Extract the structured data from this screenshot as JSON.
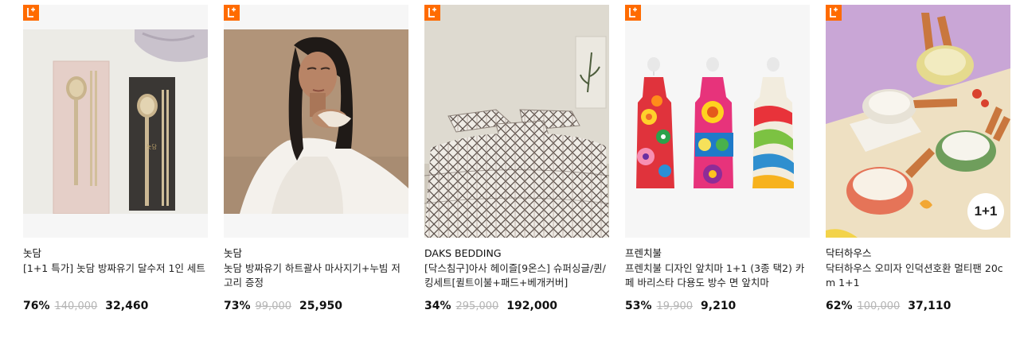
{
  "colors": {
    "lplus_badge": "#ff6b00",
    "original_price": "#b5b5b5"
  },
  "products": [
    {
      "brand": "놋담",
      "title": "[1+1 특가] 놋담 방짜유기 달수저 1인 세트",
      "discount": "76%",
      "original_price": "140,000",
      "sale_price": "32,460",
      "badge": "L+"
    },
    {
      "brand": "놋담",
      "title": "놋담 방짜유기 하트괄사 마사지기+누빔 저고리 증정",
      "discount": "73%",
      "original_price": "99,000",
      "sale_price": "25,950",
      "badge": "L+"
    },
    {
      "brand": "DAKS BEDDING",
      "title": "[닥스침구]아사 헤이즐[9온스] 슈퍼싱글/퀸/킹세트[퀼트이불+패드+베개커버]",
      "discount": "34%",
      "original_price": "295,000",
      "sale_price": "192,000",
      "badge": "L+"
    },
    {
      "brand": "프렌치불",
      "title": "프렌치불 디자인 앞치마 1+1 (3종 택2) 카페 바리스타 다용도 방수 면 앞치마",
      "discount": "53%",
      "original_price": "19,900",
      "sale_price": "9,210",
      "badge": "L+"
    },
    {
      "brand": "닥터하우스",
      "title": "닥터하우스 오미자 인덕션호환 멀티팬 20cm 1+1",
      "discount": "62%",
      "original_price": "100,000",
      "sale_price": "37,110",
      "badge": "L+",
      "promo_badge": "1+1"
    }
  ]
}
